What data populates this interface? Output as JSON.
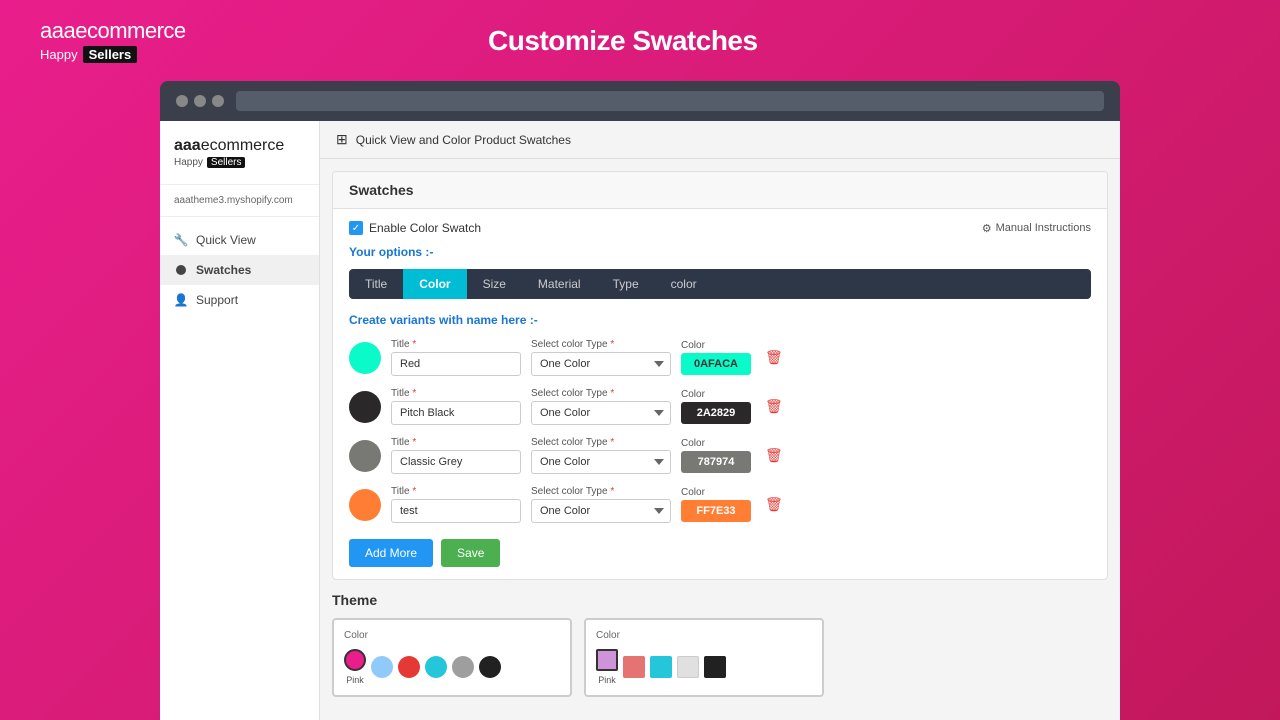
{
  "brand": {
    "name_bold": "aaa",
    "name_light": "ecommerce",
    "tagline_text": "Happy",
    "tagline_highlight": "Sellers"
  },
  "page_title": "Customize Swatches",
  "browser": {
    "dots": [
      "",
      "",
      ""
    ]
  },
  "sidebar": {
    "store_url": "aaatheme3.myshopify.com",
    "nav_items": [
      {
        "label": "Quick View",
        "icon": "wrench"
      },
      {
        "label": "Swatches",
        "icon": "dot",
        "active": true
      },
      {
        "label": "Support",
        "icon": "user"
      }
    ]
  },
  "app_header": {
    "icon": "⊞",
    "title": "Quick View and Color Product Swatches"
  },
  "swatches": {
    "panel_title": "Swatches",
    "enable_label": "Enable Color Swatch",
    "manual_label": "Manual Instructions",
    "your_options_label": "Your options :-",
    "tabs": [
      {
        "label": "Title",
        "active": false
      },
      {
        "label": "Color",
        "active": true
      },
      {
        "label": "Size",
        "active": false
      },
      {
        "label": "Material",
        "active": false
      },
      {
        "label": "Type",
        "active": false
      },
      {
        "label": "color",
        "active": false
      }
    ],
    "create_label": "Create variants with name here :-",
    "title_field_label": "Title *",
    "select_color_label": "Select color Type *",
    "color_label": "Color",
    "rows": [
      {
        "id": 1,
        "circle_color": "#0AFACA",
        "title_value": "Red",
        "select_value": "One Color",
        "color_hex": "0AFACA",
        "color_badge_bg": "#0AFACA"
      },
      {
        "id": 2,
        "circle_color": "#2A2829",
        "title_value": "Pitch Black",
        "select_value": "One Color",
        "color_hex": "2A2829",
        "color_badge_bg": "#2A2829"
      },
      {
        "id": 3,
        "circle_color": "#787974",
        "title_value": "Classic Grey",
        "select_value": "One Color",
        "color_hex": "787974",
        "color_badge_bg": "#787974"
      },
      {
        "id": 4,
        "circle_color": "#FF7E33",
        "title_value": "test",
        "select_value": "One Color",
        "color_hex": "FF7E33",
        "color_badge_bg": "#FF7E33"
      }
    ],
    "btn_add": "Add More",
    "btn_save": "Save"
  },
  "theme": {
    "label": "Theme",
    "circle_preview": {
      "label": "Color",
      "swatches": [
        {
          "color": "#E91E8C",
          "selected": true,
          "label": "Pink"
        },
        {
          "color": "#90CAF9"
        },
        {
          "color": "#E53935"
        },
        {
          "color": "#26C6DA"
        },
        {
          "color": "#9E9E9E"
        },
        {
          "color": "#212121"
        }
      ]
    },
    "square_preview": {
      "label": "Color",
      "swatches": [
        {
          "color": "#CE93D8",
          "selected": true,
          "label": "Pink"
        },
        {
          "color": "#E57373"
        },
        {
          "color": "#26C6DA"
        },
        {
          "color": "#E0E0E0"
        },
        {
          "color": "#212121"
        }
      ]
    }
  }
}
